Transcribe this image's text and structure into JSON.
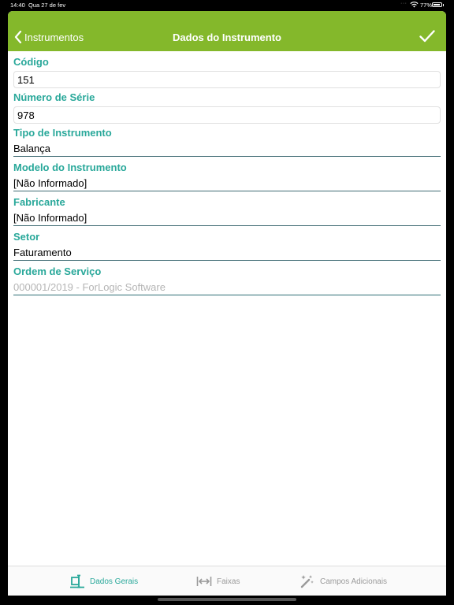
{
  "status_bar": {
    "time": "14:40",
    "date": "Qua 27 de fev",
    "battery": "77%"
  },
  "nav": {
    "back_label": "Instrumentos",
    "title": "Dados do Instrumento"
  },
  "form": {
    "codigo": {
      "label": "Código",
      "value": "151"
    },
    "numero_serie": {
      "label": "Número de Série",
      "value": "978"
    },
    "tipo": {
      "label": "Tipo de Instrumento",
      "value": "Balança"
    },
    "modelo": {
      "label": "Modelo do Instrumento",
      "value": "[Não Informado]"
    },
    "fabricante": {
      "label": "Fabricante",
      "value": "[Não Informado]"
    },
    "setor": {
      "label": "Setor",
      "value": "Faturamento"
    },
    "ordem_servico": {
      "label": "Ordem de Serviço",
      "value": "000001/2019 - ForLogic Software"
    }
  },
  "tabs": [
    {
      "label": "Dados Gerais",
      "icon": "general-data-icon",
      "active": true
    },
    {
      "label": "Faixas",
      "icon": "range-arrows-icon",
      "active": false
    },
    {
      "label": "Campos Adicionais",
      "icon": "magic-wand-icon",
      "active": false
    }
  ],
  "colors": {
    "nav_green": "#84b82b",
    "label_teal": "#29a89a",
    "inactive_gray": "#9a9a9a"
  }
}
